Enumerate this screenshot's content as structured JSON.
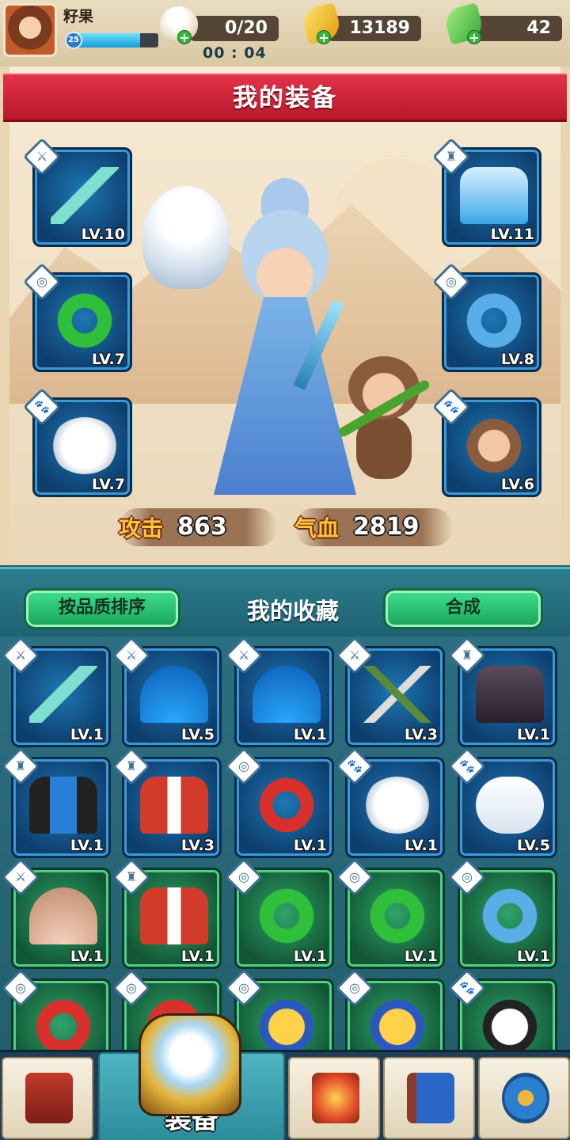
{
  "player": {
    "name": "籽果",
    "level": "25",
    "xp_fraction": 0.78
  },
  "resources": {
    "stamina": "0/20",
    "timer": "00 : 04",
    "gold": "13189",
    "gems": "42"
  },
  "equip_panel": {
    "title": "我的装备",
    "slots_left": [
      {
        "type": "weapon",
        "level": "LV.10",
        "item": "jade-dagger"
      },
      {
        "type": "accessory",
        "level": "LV.7",
        "item": "dragon-jade-pendant"
      },
      {
        "type": "pet",
        "level": "LV.7",
        "item": "white-owl"
      }
    ],
    "slots_right": [
      {
        "type": "armor",
        "level": "LV.11",
        "item": "ice-robe"
      },
      {
        "type": "accessory",
        "level": "LV.8",
        "item": "blue-jade-pendant"
      },
      {
        "type": "pet",
        "level": "LV.6",
        "item": "monkey"
      }
    ],
    "stats": {
      "attack_label": "攻击",
      "attack_value": "863",
      "hp_label": "气血",
      "hp_value": "2819"
    }
  },
  "collection": {
    "sort_button": "按品质排序",
    "title": "我的收藏",
    "merge_button": "合成",
    "rows": [
      [
        {
          "type": "weapon",
          "level": "LV.1",
          "quality": "blue",
          "item": "jade-dagger"
        },
        {
          "type": "weapon",
          "level": "LV.5",
          "quality": "blue",
          "item": "blue-fan"
        },
        {
          "type": "weapon",
          "level": "LV.1",
          "quality": "blue",
          "item": "blue-fan"
        },
        {
          "type": "weapon",
          "level": "LV.3",
          "quality": "blue",
          "item": "crossbow"
        },
        {
          "type": "armor",
          "level": "LV.1",
          "quality": "blue",
          "item": "dark-robe"
        }
      ],
      [
        {
          "type": "armor",
          "level": "LV.1",
          "quality": "blue",
          "item": "blue-vest"
        },
        {
          "type": "armor",
          "level": "LV.3",
          "quality": "blue",
          "item": "red-robe"
        },
        {
          "type": "accessory",
          "level": "LV.1",
          "quality": "blue",
          "item": "phoenix-pendant"
        },
        {
          "type": "pet",
          "level": "LV.1",
          "quality": "blue",
          "item": "white-owl"
        },
        {
          "type": "pet",
          "level": "LV.5",
          "quality": "blue",
          "item": "white-ferret"
        }
      ],
      [
        {
          "type": "weapon",
          "level": "LV.1",
          "quality": "green",
          "item": "paper-fan"
        },
        {
          "type": "armor",
          "level": "LV.1",
          "quality": "green",
          "item": "red-robe"
        },
        {
          "type": "accessory",
          "level": "LV.1",
          "quality": "green",
          "item": "dragon-jade-pendant"
        },
        {
          "type": "accessory",
          "level": "LV.1",
          "quality": "green",
          "item": "dragon-jade-pendant"
        },
        {
          "type": "accessory",
          "level": "LV.1",
          "quality": "green",
          "item": "blue-jade-pendant"
        }
      ],
      [
        {
          "type": "accessory",
          "level": "",
          "quality": "green",
          "item": "phoenix-pendant"
        },
        {
          "type": "accessory",
          "level": "",
          "quality": "green",
          "item": "phoenix-pendant"
        },
        {
          "type": "accessory",
          "level": "",
          "quality": "green",
          "item": "golden-pendant"
        },
        {
          "type": "accessory",
          "level": "",
          "quality": "green",
          "item": "golden-pendant"
        },
        {
          "type": "pet",
          "level": "",
          "quality": "green",
          "item": "panda"
        }
      ]
    ]
  },
  "nav": {
    "items": [
      {
        "name": "treasure-shop",
        "label": ""
      },
      {
        "name": "equipment",
        "label": "装备",
        "active": true
      },
      {
        "name": "forge",
        "label": ""
      },
      {
        "name": "codex",
        "label": ""
      },
      {
        "name": "settings",
        "label": ""
      }
    ]
  },
  "colors": {
    "banner_red": "#c8203a",
    "slot_blue": "#1d77b4",
    "slot_green": "#2ea46a",
    "button_green": "#2bc776",
    "header_teal": "#2d7d8d"
  },
  "icons": {
    "tag_weapon": "sword-icon",
    "tag_armor": "armor-icon",
    "tag_accessory": "pendant-icon",
    "tag_pet": "paw-icon"
  }
}
